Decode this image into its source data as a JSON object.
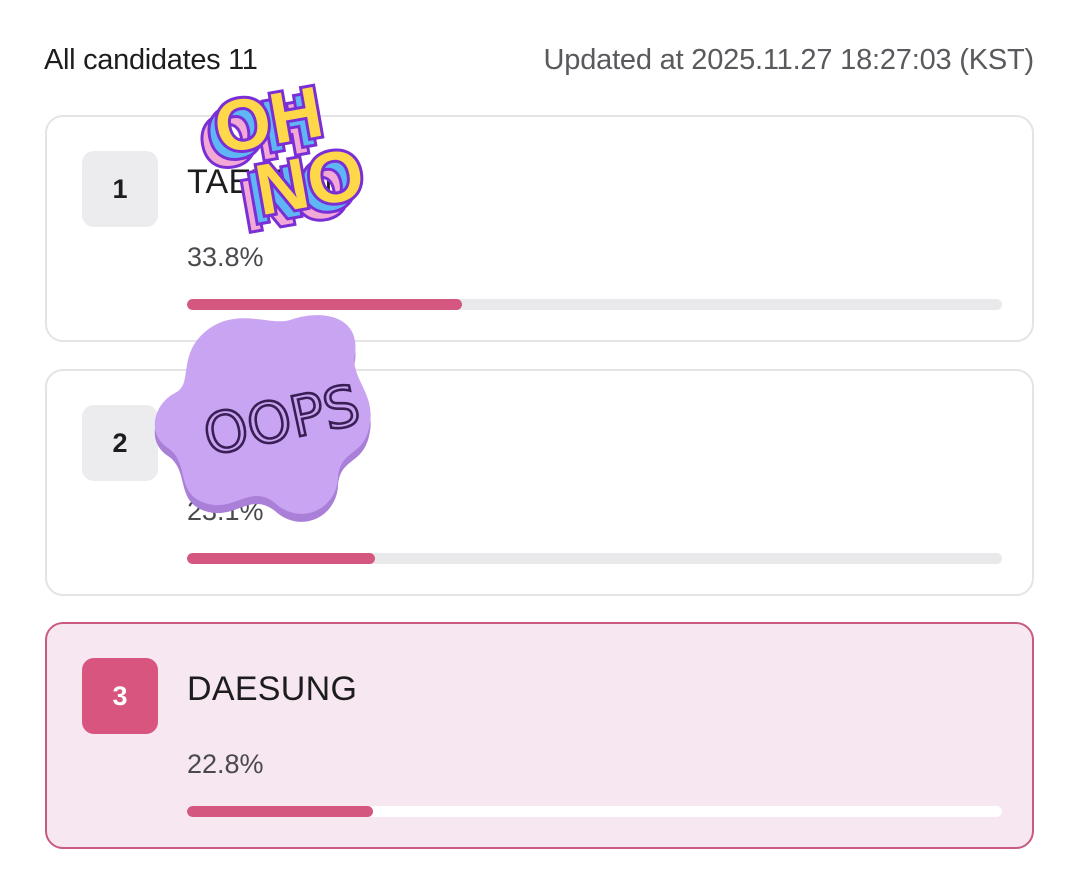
{
  "header": {
    "all_candidates_label": "All candidates 11",
    "updated_at": "Updated at 2025.11.27 18:27:03 (KST)"
  },
  "candidates": [
    {
      "rank": "1",
      "name": "TAEYEON",
      "percent_label": "33.8%",
      "share": 0.338
    },
    {
      "rank": "2",
      "name": "",
      "percent_label": "23.1%",
      "share": 0.231
    },
    {
      "rank": "3",
      "name": "DAESUNG",
      "percent_label": "22.8%",
      "share": 0.228
    }
  ],
  "stickers": {
    "oh_no": {
      "line1": "OH",
      "line2": "NO"
    },
    "oops": {
      "text": "OOPS"
    }
  },
  "colors": {
    "accent": "#d4577f",
    "highlight_bg": "#f6e7f0",
    "highlight_border": "#c95b82",
    "oops_blob": "#c9a4f3",
    "oh_no_yellow": "#ffd84a",
    "oh_no_purple": "#7a2fd6"
  }
}
